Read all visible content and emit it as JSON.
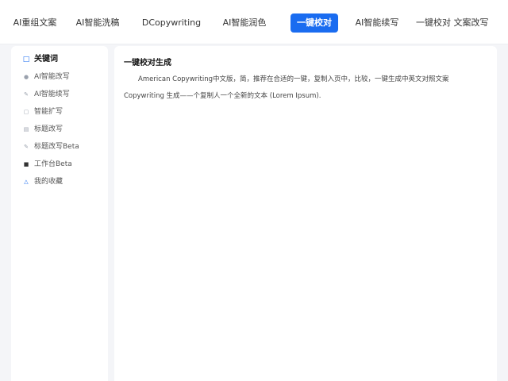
{
  "top_nav": {
    "tabs": [
      {
        "label": "AI重组文案"
      },
      {
        "label": "AI智能洗稿"
      },
      {
        "label": "DCopywriting"
      },
      {
        "label": "AI智能润色"
      },
      {
        "label": "一键校对"
      },
      {
        "label": "AI智能续写"
      },
      {
        "label": "一键校对 文案改写"
      }
    ],
    "active_index": 4
  },
  "sidebar": {
    "items": [
      {
        "label": "关键词",
        "icon": "doc-icon"
      },
      {
        "label": "AI智能改写",
        "icon": "dot-icon"
      },
      {
        "label": "AI智能续写",
        "icon": "pen-icon"
      },
      {
        "label": "智能扩写",
        "icon": "expand-icon"
      },
      {
        "label": "标题改写",
        "icon": "title-icon"
      },
      {
        "label": "标题改写Beta",
        "icon": "edit-icon"
      },
      {
        "label": "工作台Beta",
        "icon": "square-icon"
      },
      {
        "label": "我的收藏",
        "icon": "bell-icon"
      }
    ],
    "active_index": 0
  },
  "main": {
    "title": "一键校对生成",
    "paragraph": "American Copywriting中文版，简，推荐在合适的一键，复制入页中，比较，一键生成中英文对照文案 Copywriting 生成——个复制人一个全新的文本 (Lorem Ipsum)."
  },
  "colors": {
    "accent": "#1a6cf0",
    "background": "#f4f5f8",
    "panel": "#ffffff"
  }
}
